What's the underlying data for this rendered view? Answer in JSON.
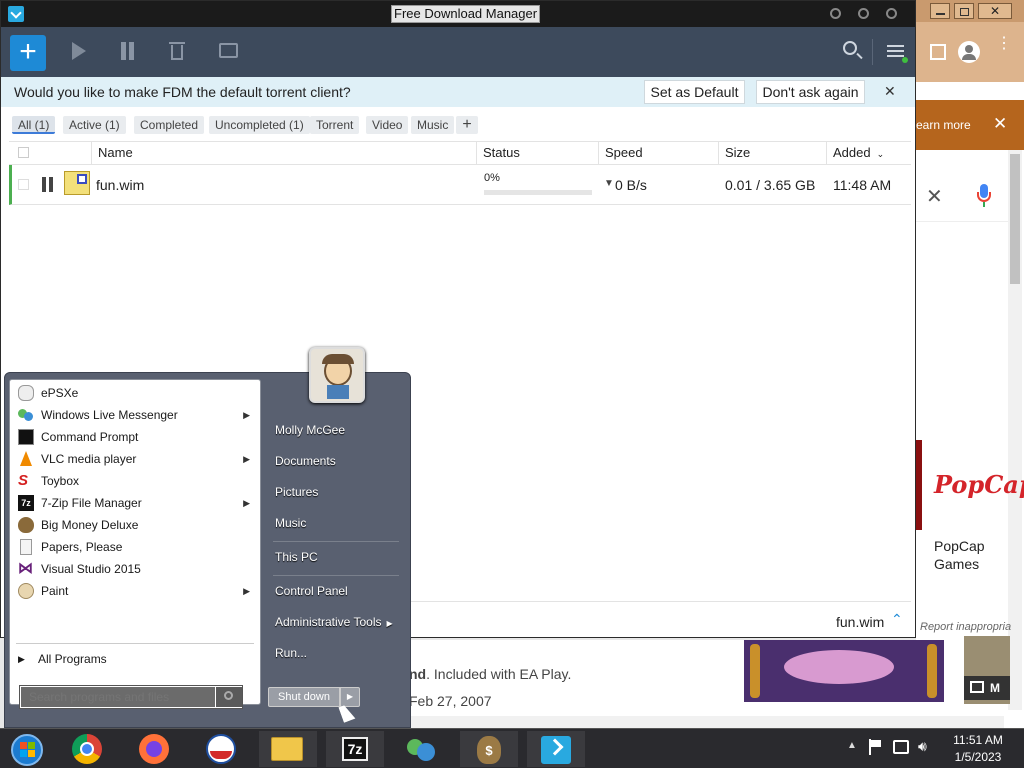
{
  "fdm": {
    "title": "Free Download Manager",
    "notice": {
      "text": "Would you like to make FDM the default torrent client?",
      "set_default": "Set as Default",
      "dont_ask": "Don't ask again"
    },
    "filters": [
      "All (1)",
      "Active (1)",
      "Completed",
      "Uncompleted (1)",
      "Torrent",
      "Video",
      "Music"
    ],
    "columns": {
      "name": "Name",
      "status": "Status",
      "speed": "Speed",
      "size": "Size",
      "added": "Added"
    },
    "download": {
      "name": "fun.wim",
      "progress_text": "0%",
      "progress": 0,
      "speed": "0 B/s",
      "size": "0.01 / 3.65 GB",
      "added": "11:48 AM"
    },
    "bottom_file": "fun.wim"
  },
  "background_browser": {
    "learn_more": "earn more",
    "popcap_logo": "PopCap",
    "popcap_label": "PopCap Games",
    "report": "Report inappropria",
    "ea_text_bold": "nd",
    "ea_text": ". Included with EA Play.",
    "date_text": "Feb 27, 2007",
    "tile_letter": "M"
  },
  "start_menu": {
    "programs": [
      {
        "label": "ePSXe",
        "icon": "gamepad-icon",
        "arrow": false
      },
      {
        "label": "Windows Live Messenger",
        "icon": "messenger-icon",
        "arrow": true
      },
      {
        "label": "Command Prompt",
        "icon": "cmd-icon",
        "arrow": false
      },
      {
        "label": "VLC media player",
        "icon": "vlc-icon",
        "arrow": true
      },
      {
        "label": "Toybox",
        "icon": "toybox-icon",
        "arrow": false
      },
      {
        "label": "7-Zip File Manager",
        "icon": "7zip-icon",
        "arrow": true
      },
      {
        "label": "Big Money Deluxe",
        "icon": "moneybag-icon",
        "arrow": false
      },
      {
        "label": "Papers, Please",
        "icon": "document-icon",
        "arrow": false
      },
      {
        "label": "Visual Studio 2015",
        "icon": "visual-studio-icon",
        "arrow": false
      },
      {
        "label": "Paint",
        "icon": "paint-icon",
        "arrow": true
      }
    ],
    "all_programs": "All Programs",
    "search_placeholder": "Search programs and files",
    "user": "Molly McGee",
    "right_items": [
      "Documents",
      "Pictures",
      "Music",
      "This PC",
      "Control Panel",
      "Administrative Tools",
      "Run..."
    ],
    "shutdown": "Shut down"
  },
  "taskbar": {
    "time": "11:51 AM",
    "date": "1/5/2023",
    "apps": [
      "start-orb-icon",
      "chrome-icon",
      "firefox-icon",
      "obama-logo-icon",
      "file-explorer-icon",
      "7zip-icon",
      "messenger-icon",
      "moneybag-icon",
      "fdm-icon"
    ]
  },
  "colors": {
    "fdm_toolbar": "#3d4a5c",
    "fdm_accent": "#1e8ad6",
    "notice_bg": "#dff0f7",
    "popcap_red": "#d4242a",
    "taskbar": "#2a2a2e"
  }
}
